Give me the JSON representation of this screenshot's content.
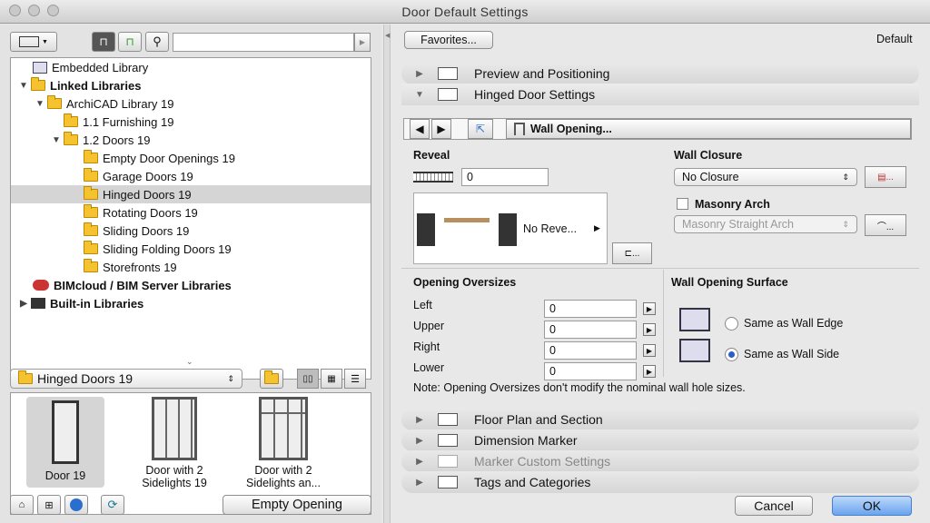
{
  "window": {
    "title": "Door Default Settings"
  },
  "left": {
    "search_placeholder": "",
    "tree": [
      {
        "label": "Embedded Library",
        "bold": false
      },
      {
        "label": "Linked Libraries",
        "bold": true
      },
      {
        "label": "ArchiCAD Library 19",
        "bold": false
      },
      {
        "label": "1.1 Furnishing 19",
        "bold": false
      },
      {
        "label": "1.2 Doors 19",
        "bold": false
      },
      {
        "label": "Empty Door Openings 19",
        "bold": false
      },
      {
        "label": "Garage Doors 19",
        "bold": false
      },
      {
        "label": "Hinged Doors 19",
        "bold": false
      },
      {
        "label": "Rotating Doors 19",
        "bold": false
      },
      {
        "label": "Sliding Doors 19",
        "bold": false
      },
      {
        "label": "Sliding Folding Doors 19",
        "bold": false
      },
      {
        "label": "Storefronts 19",
        "bold": false
      },
      {
        "label": "BIMcloud / BIM Server Libraries",
        "bold": true
      },
      {
        "label": "Built-in Libraries",
        "bold": true
      }
    ],
    "folder_popup": "Hinged Doors 19",
    "gallery": [
      {
        "line1": "Door 19",
        "line2": ""
      },
      {
        "line1": "Door with 2",
        "line2": "Sidelights 19"
      },
      {
        "line1": "Door with 2",
        "line2": "Sidelights an..."
      }
    ],
    "empty_opening_button": "Empty Opening"
  },
  "right": {
    "favorites_button": "Favorites...",
    "default_label": "Default",
    "sections": {
      "preview": "Preview and Positioning",
      "hinged": "Hinged Door Settings",
      "floor": "Floor Plan and Section",
      "dimension": "Dimension Marker",
      "marker": "Marker Custom Settings",
      "tags": "Tags and Categories"
    },
    "page_popup": "Wall Opening...",
    "reveal": {
      "title": "Reveal",
      "value": "0",
      "preview_label": "No Reve..."
    },
    "wall_closure": {
      "title": "Wall Closure",
      "value": "No Closure",
      "masonry_label": "Masonry Arch",
      "masonry_value": "Masonry Straight Arch"
    },
    "oversizes": {
      "title": "Opening Oversizes",
      "rows": [
        {
          "label": "Left",
          "value": "0"
        },
        {
          "label": "Upper",
          "value": "0"
        },
        {
          "label": "Right",
          "value": "0"
        },
        {
          "label": "Lower",
          "value": "0"
        }
      ],
      "note": "Note: Opening Oversizes don't modify the nominal wall hole sizes."
    },
    "surface": {
      "title": "Wall Opening Surface",
      "option1": "Same as Wall Edge",
      "option2": "Same as Wall Side"
    },
    "cancel_button": "Cancel",
    "ok_button": "OK"
  },
  "colors": {
    "accent": "#2a5fc9",
    "folder": "#f5c330",
    "selection": "#d5d5d5"
  }
}
